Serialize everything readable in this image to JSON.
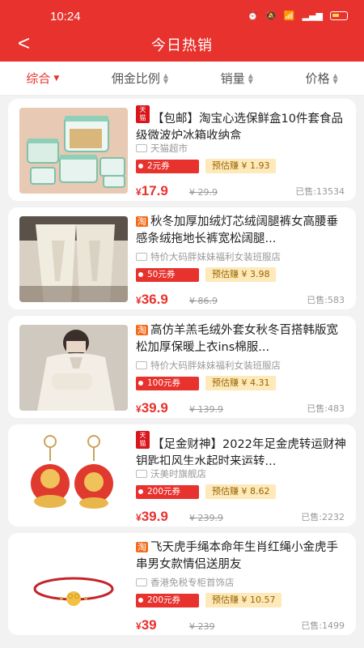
{
  "status": {
    "time": "10:24"
  },
  "header": {
    "title": "今日热销"
  },
  "sort": [
    {
      "label": "综合",
      "active": true
    },
    {
      "label": "佣金比例"
    },
    {
      "label": "销量"
    },
    {
      "label": "价格"
    }
  ],
  "products": [
    {
      "platform": "tmall",
      "badge": "天猫",
      "title": "【包邮】淘宝心选保鲜盒10件套食品级微波炉冰箱收纳盒",
      "shop": "天猫超市",
      "coupon": "2元券",
      "estimate": "预估赚 ¥ 1.93",
      "price_symbol": "¥",
      "price": "17.9",
      "original": "¥ 29.9",
      "sold": "已售:13534"
    },
    {
      "platform": "taobao",
      "badge": "淘",
      "title": "秋冬加厚加绒灯芯绒阔腿裤女高腰垂感条绒拖地长裤宽松阔腿...",
      "shop": "特价大码胖妹妹福利女装班服店",
      "coupon": "50元券",
      "estimate": "预估赚 ¥ 3.98",
      "price_symbol": "¥",
      "price": "36.9",
      "original": "¥ 86.9",
      "sold": "已售:583"
    },
    {
      "platform": "taobao",
      "badge": "淘",
      "title": "高仿羊羔毛绒外套女秋冬百搭韩版宽松加厚保暖上衣ins棉服...",
      "shop": "特价大码胖妹妹福利女装班服店",
      "coupon": "100元券",
      "estimate": "预估赚 ¥ 4.31",
      "price_symbol": "¥",
      "price": "39.9",
      "original": "¥ 139.9",
      "sold": "已售:483"
    },
    {
      "platform": "tmall",
      "badge": "天猫",
      "title": "【足金财神】2022年足金虎转运财神钥匙扣风生水起时来运转...",
      "shop": "沃美时旗舰店",
      "coupon": "200元券",
      "estimate": "预估赚 ¥ 8.62",
      "price_symbol": "¥",
      "price": "39.9",
      "original": "¥ 239.9",
      "sold": "已售:2232"
    },
    {
      "platform": "taobao",
      "badge": "淘",
      "title": "飞天虎手绳本命年生肖红绳小金虎手串男女款情侣送朋友",
      "shop": "香港免税专柜首饰店",
      "coupon": "200元券",
      "estimate": "预估赚 ¥ 10.57",
      "price_symbol": "¥",
      "price": "39",
      "original": "¥ 239",
      "sold": "已售:1499"
    }
  ],
  "colors": {
    "brand": "#e8322d",
    "estimate_bg": "#fde9b9",
    "estimate_text": "#9a6400"
  }
}
